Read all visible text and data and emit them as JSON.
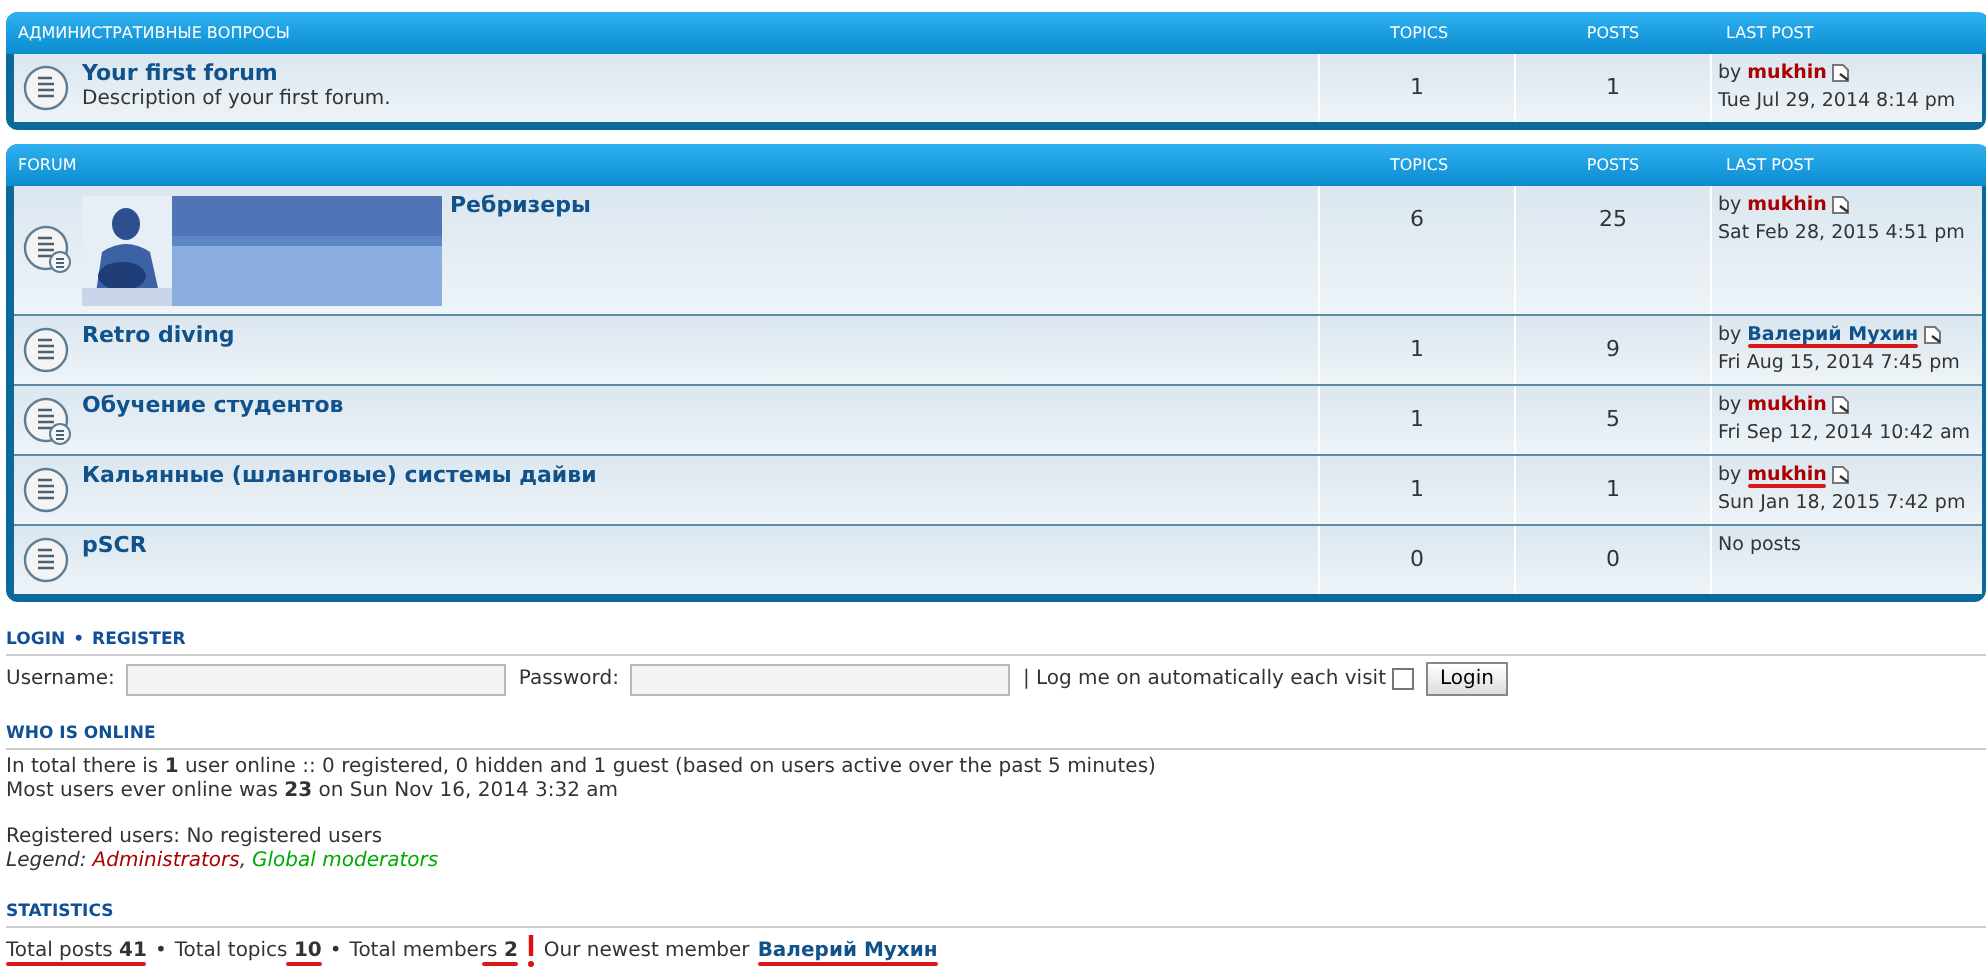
{
  "categories": [
    {
      "title": "АДМИНИСТРАТИВНЫЕ ВОПРОСЫ",
      "columns": [
        "TOPICS",
        "POSTS",
        "LAST POST"
      ],
      "forums": [
        {
          "name": "Your first forum",
          "description": "Description of your first forum.",
          "kind": "plain",
          "topics": "1",
          "posts": "1",
          "last_post": {
            "kind": "post",
            "by": "by",
            "author": "mukhin",
            "color": "#aa0000",
            "underlined": false,
            "date": "Tue Jul 29, 2014 8:14 pm"
          }
        }
      ]
    },
    {
      "title": "FORUM",
      "columns": [
        "TOPICS",
        "POSTS",
        "LAST POST"
      ],
      "forums": [
        {
          "name": "Ребризеры",
          "kind": "with_subforums",
          "topics": "6",
          "posts": "25",
          "last_post": {
            "kind": "post",
            "by": "by",
            "author": "mukhin",
            "color": "#aa0000",
            "underlined": false,
            "date": "Sat Feb 28, 2015 4:51 pm"
          }
        },
        {
          "name": "Retro diving",
          "kind": "plain",
          "topics": "1",
          "posts": "9",
          "last_post": {
            "kind": "post",
            "by": "by",
            "author": "Валерий Мухин",
            "color": "#105289",
            "underlined": true,
            "date": "Fri Aug 15, 2014 7:45 pm"
          }
        },
        {
          "name": "Обучение студентов",
          "kind": "with_subforums",
          "topics": "1",
          "posts": "5",
          "last_post": {
            "kind": "post",
            "by": "by",
            "author": "mukhin",
            "color": "#aa0000",
            "underlined": false,
            "date": "Fri Sep 12, 2014 10:42 am"
          }
        },
        {
          "name": "Кальянные (шланговые) системы дайви",
          "kind": "plain",
          "topics": "1",
          "posts": "1",
          "last_post": {
            "kind": "post",
            "by": "by",
            "author": "mukhin",
            "color": "#aa0000",
            "underlined": true,
            "date": "Sun Jan 18, 2015 7:42 pm"
          }
        },
        {
          "name": "pSCR",
          "kind": "plain",
          "topics": "0",
          "posts": "0",
          "last_post": {
            "kind": "empty",
            "text": "No posts"
          }
        }
      ]
    }
  ],
  "login": {
    "title": "LOGIN",
    "separator": "•",
    "register": "REGISTER",
    "username_label": "Username:",
    "password_label": "Password:",
    "remember_label": "| Log me on automatically each visit",
    "remember_checked": false,
    "button": "Login"
  },
  "who_is_online": {
    "title": "WHO IS ONLINE",
    "lines": [
      "In total there is **1** user online :: 0 registered, 0 hidden and 1 guest (based on users active over the past 5 minutes)",
      "Most users ever online was **23** on Sun Nov 16, 2014 3:32 am"
    ],
    "registered": "Registered users: No registered users",
    "legend": {
      "label": "Legend:",
      "groups": [
        {
          "name": "Administrators",
          "color": "#aa0000"
        },
        {
          "name": "Global moderators",
          "color": "#00aa00"
        }
      ],
      "separator": ","
    }
  },
  "statistics": {
    "title": "STATISTICS",
    "parts": [
      {
        "kind": "stat",
        "label": "Total posts",
        "value": "41",
        "label_underlined": true,
        "value_underlined": true
      },
      {
        "kind": "separator",
        "text": "•"
      },
      {
        "kind": "stat",
        "label": "Total topics",
        "value": "10",
        "label_underlined": false,
        "value_underlined": true
      },
      {
        "kind": "separator",
        "text": "•"
      },
      {
        "kind": "stat",
        "label": "Total members",
        "value": "2",
        "label_underlined": false,
        "value_underlined": true
      },
      {
        "kind": "mark"
      },
      {
        "kind": "text",
        "text": "Our newest member"
      },
      {
        "kind": "member",
        "text": "Валерий Мухин",
        "underlined": true
      }
    ]
  }
}
